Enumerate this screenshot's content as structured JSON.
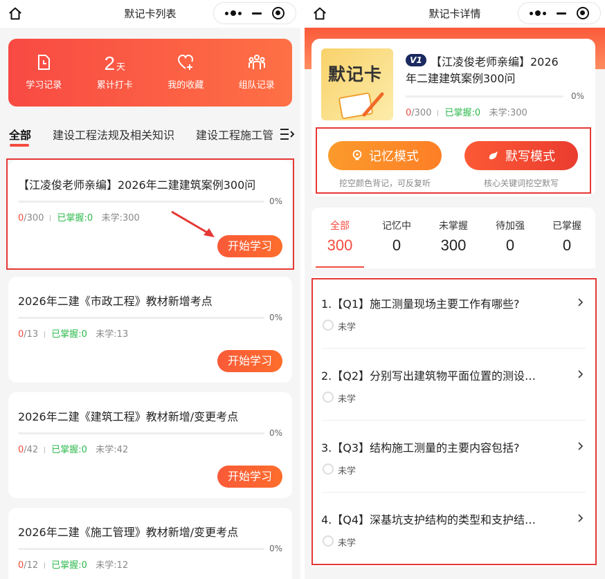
{
  "colors": {
    "accent": "#f44b3e",
    "green": "#2cb84b",
    "highlight": "#e53935"
  },
  "left": {
    "nav_title": "默记卡列表",
    "banner": [
      {
        "icon": "study-record-icon",
        "label": "学习记录"
      },
      {
        "num": "2",
        "unit": "天",
        "label": "累计打卡"
      },
      {
        "icon": "favorite-heart-icon",
        "label": "我的收藏"
      },
      {
        "icon": "team-group-icon",
        "label": "组队记录"
      }
    ],
    "tabs": [
      "全部",
      "建设工程法规及相关知识",
      "建设工程施工管"
    ],
    "cards": [
      {
        "title": "【江凌俊老师亲编】2026年二建建筑案例300问",
        "pct": "0%",
        "done": "0",
        "total": "/300",
        "mastered_label": "已掌握:",
        "mastered": "0",
        "unlearned_label": "未学:",
        "unlearned": "300",
        "button": "开始学习"
      },
      {
        "title": "2026年二建《市政工程》教材新增考点",
        "pct": "0%",
        "done": "0",
        "total": "/13",
        "mastered_label": "已掌握:",
        "mastered": "0",
        "unlearned_label": "未学:",
        "unlearned": "13",
        "button": "开始学习"
      },
      {
        "title": "2026年二建《建筑工程》教材新增/变更考点",
        "pct": "0%",
        "done": "0",
        "total": "/42",
        "mastered_label": "已掌握:",
        "mastered": "0",
        "unlearned_label": "未学:",
        "unlearned": "42",
        "button": "开始学习"
      },
      {
        "title": "2026年二建《施工管理》教材新增/变更考点",
        "pct": "0%",
        "done": "0",
        "total": "/12",
        "mastered_label": "已掌握:",
        "mastered": "0",
        "unlearned_label": "未学:",
        "unlearned": "12",
        "button": "开始学习"
      }
    ]
  },
  "right": {
    "nav_title": "默记卡详情",
    "cover_text": "默记卡",
    "badge": "V1",
    "title_line1": "【江凌俊老师亲编】2026",
    "title_line2": "年二建建筑案例300问",
    "pct": "0%",
    "done": "0",
    "total": "/300",
    "mastered_label": "已掌握:",
    "mastered": "0",
    "unlearned_label": "未学:",
    "unlearned": "300",
    "modes": [
      {
        "label": "记忆模式",
        "sub": "挖空颜色背记，可反复听",
        "icon": "bulb-icon"
      },
      {
        "label": "默写模式",
        "sub": "核心关键词挖空默写",
        "icon": "pen-icon"
      }
    ],
    "stat_tabs": [
      {
        "label": "全部",
        "value": "300"
      },
      {
        "label": "记忆中",
        "value": "0"
      },
      {
        "label": "未掌握",
        "value": "300"
      },
      {
        "label": "待加强",
        "value": "0"
      },
      {
        "label": "已掌握",
        "value": "0"
      }
    ],
    "questions": [
      {
        "text": "1.【Q1】施工测量现场主要工作有哪些?",
        "status": "未学"
      },
      {
        "text": "2.【Q2】分别写出建筑物平面位置的测设…",
        "status": "未学"
      },
      {
        "text": "3.【Q3】结构施工测量的主要内容包括?",
        "status": "未学"
      },
      {
        "text": "4.【Q4】深基坑支护结构的类型和支护结…",
        "status": "未学"
      }
    ]
  }
}
